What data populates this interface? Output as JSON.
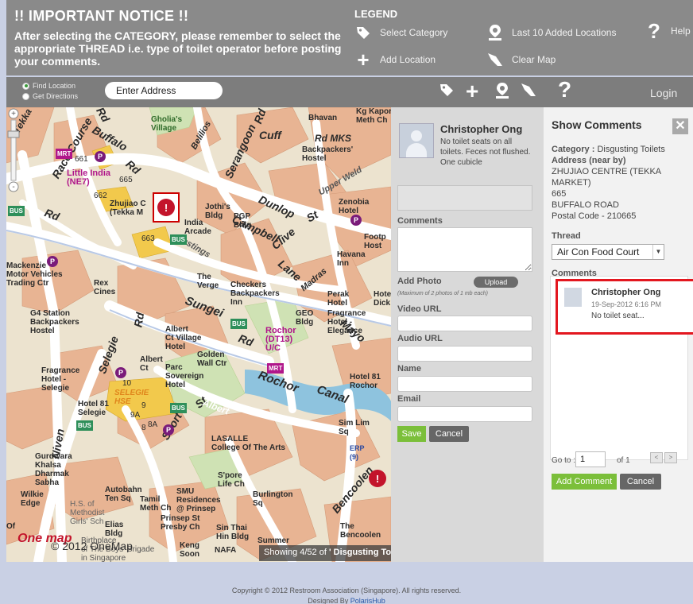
{
  "notice": {
    "title": "!! IMPORTANT NOTICE !!",
    "text": "After selecting the CATEGORY, please remember to select the appropriate THREAD i.e. type of toilet operator before posting your comments."
  },
  "legend": {
    "title": "LEGEND",
    "items": [
      {
        "label": "Select Category",
        "icon": "tag-icon"
      },
      {
        "label": "Last 10 Added Locations",
        "icon": "location-pin-icon"
      },
      {
        "label": "Help",
        "icon": "question-icon"
      },
      {
        "label": "Add Location",
        "icon": "plus-icon"
      },
      {
        "label": "Clear Map",
        "icon": "eraser-icon"
      }
    ]
  },
  "toolbar": {
    "find_location": "Find Location",
    "get_directions": "Get Directions",
    "address_value": "Enter Address",
    "login": "Login"
  },
  "map": {
    "labels": {
      "bhavan": "Bhavan",
      "kg_kapor": "Kg Kapor\nMeth Ch",
      "gholias": "Gholia's\nVillage",
      "cuff_rd": "Cuff",
      "rd_mks": "Rd MKS",
      "backpackers_hostel": "Backpackers'\nHostel",
      "little_india": "Little India\n(NE7)",
      "n665": "665",
      "n661": "661",
      "n662": "662",
      "n663": "663",
      "zhujiao": "Zhujiao C\n(Tekka M",
      "jothis": "Jothi's\nBldg",
      "pgp": "PGP\nBldg",
      "india_arcade": "India\nArcade",
      "zenobia": "Zenobia\nHotel",
      "footp": "Footp\nHost",
      "havana_inn": "Havana\nInn",
      "mackenzie": "Mackenzie\nMotor Vehicles\nTrading Ctr",
      "rex_cines": "Rex\nCines",
      "the_verge": "The\nVerge",
      "checkers": "Checkers\nBackpackers\nInn",
      "perak_hotel": "Perak\nHotel",
      "fragrance_hotel": "Fragrance\nHotel -\nElegance",
      "geo_bldg": "GEO\nBldg",
      "g4_station": "G4 Station\nBackpackers\nHostel",
      "albert_ct_village": "Albert\nCt Village\nHotel",
      "rochor_dt13": "Rochor\n(DT13)\nU/C",
      "albert_ct": "Albert\nCt",
      "parc_sovereign": "Parc\nSovereign\nHotel",
      "golden_wall": "Golden\nWall Ctr",
      "fragrance_selegie": "Fragrance\nHotel -\nSelegie",
      "hotel81_rochor": "Hotel 81\nRochor",
      "hotel81_selegie": "Hotel 81\nSelegie",
      "selegie_hse": "SELEGIE\nHSE",
      "n10": "10",
      "n9": "9",
      "n9a": "9A",
      "n8": "8",
      "n8a": "8A",
      "sim_lim": "Sim Lim\nSq",
      "erp": "ERP\n(9)",
      "lasalle": "LASALLE\nCollege Of The Arts",
      "gurdwara": "Gurdwara\nKhalsa\nDharmak\nSabha",
      "wilkie_edge": "Wilkie\nEdge",
      "autobahn": "Autobahn\nTen Sq",
      "tamil_meth": "Tamil\nMeth Ch",
      "smu": "SMU\nResidences\n@ Prinsep",
      "sport_life": "S'pore\nLife Ch",
      "burlington": "Burlington\nSq",
      "hs_methodist": "H.S. of\nMethodist\nGirls' Sch",
      "elias_bldg": "Elias\nBldg",
      "prinsep_st": "Prinsep St\nPresby Ch",
      "sin_thai": "Sin Thai\nHin Bldg",
      "the_bencoolen": "The\nBencoolen",
      "keng_soon": "Keng\nSoon",
      "nafa": "NAFA",
      "summer": "Summer",
      "birthplace": "Birthplace\nof The Boys' Brigade\nin Singapore",
      "hote_dick": "Hote\nDick",
      "of": "Of"
    },
    "roads": {
      "buffalo": "Buffalo",
      "rd1": "Rd",
      "rd2": "Rd",
      "rd3": "Rd",
      "rd4": "Rd",
      "rd5": "Rd",
      "rd6": "Rd",
      "race_course": "Race Course",
      "serangoon": "Serangoon",
      "dunlop": "Dunlop",
      "st1": "St",
      "st2": "St",
      "campbell": "Campbell",
      "clive": "Clive",
      "lane": "Lane",
      "madras": "Madras",
      "mayo": "Mayo",
      "hastings": "Hastings",
      "sungei": "Sungei",
      "selegie_rd": "Selegie",
      "rochor": "Rochor",
      "canal": "Canal",
      "albert": "Albert",
      "short": "Short",
      "niven": "Niven",
      "bencoolen": "Bencoolen",
      "tekka": "Tekka",
      "bellilos": "Belilios",
      "upper_weld": "Upper Weld"
    },
    "badges": {
      "mrt1": "MRT",
      "mrt2": "MRT",
      "bus1": "BUS",
      "bus2": "BUS",
      "bus3": "BUS",
      "bus4": "BUS",
      "bus5": "BUS"
    },
    "copyright": "© 2012 OneMap",
    "logo": "One map",
    "status_prefix": "Showing 4/52 of",
    "status_category": "' Disgusting To"
  },
  "form": {
    "author": "Christopher Ong",
    "comment": "No toilet seats on all toilets. Feces not flushed. One cubicle",
    "comments_label": "Comments",
    "add_photo_label": "Add Photo",
    "upload_label": "Upload",
    "photo_hint": "(Maximum of 2 photos of 1 mb each)",
    "video_url_label": "Video URL",
    "audio_url_label": "Audio URL",
    "name_label": "Name",
    "email_label": "Email",
    "save_label": "Save",
    "cancel_label": "Cancel"
  },
  "comments": {
    "title": "Show Comments",
    "close": "✕",
    "category_key": "Category :",
    "category_value": "Disgusting Toilets",
    "address_key": "Address (near by)",
    "address_line1": "ZHUJIAO CENTRE (TEKKA MARKET)",
    "address_line2": "665",
    "address_line3": "BUFFALO ROAD",
    "postal": "Postal Code - 210665",
    "thread_label": "Thread",
    "thread_value": "Air Con Food Court",
    "comments_label": "Comments",
    "entry": {
      "author": "Christopher Ong",
      "date": "19-Sep-2012 6:16 PM",
      "text": "No toilet seat..."
    },
    "goto_label": "Go to :",
    "goto_value": "1",
    "of_label": "of 1",
    "prev": "<",
    "next": ">",
    "add_comment_label": "Add Comment",
    "cancel_label": "Cancel"
  },
  "footer": {
    "copyright": "Copyright © 2012 Restroom Association (Singapore). All rights reserved.",
    "designed_by": "Designed By",
    "designer": "PolarisHub"
  }
}
